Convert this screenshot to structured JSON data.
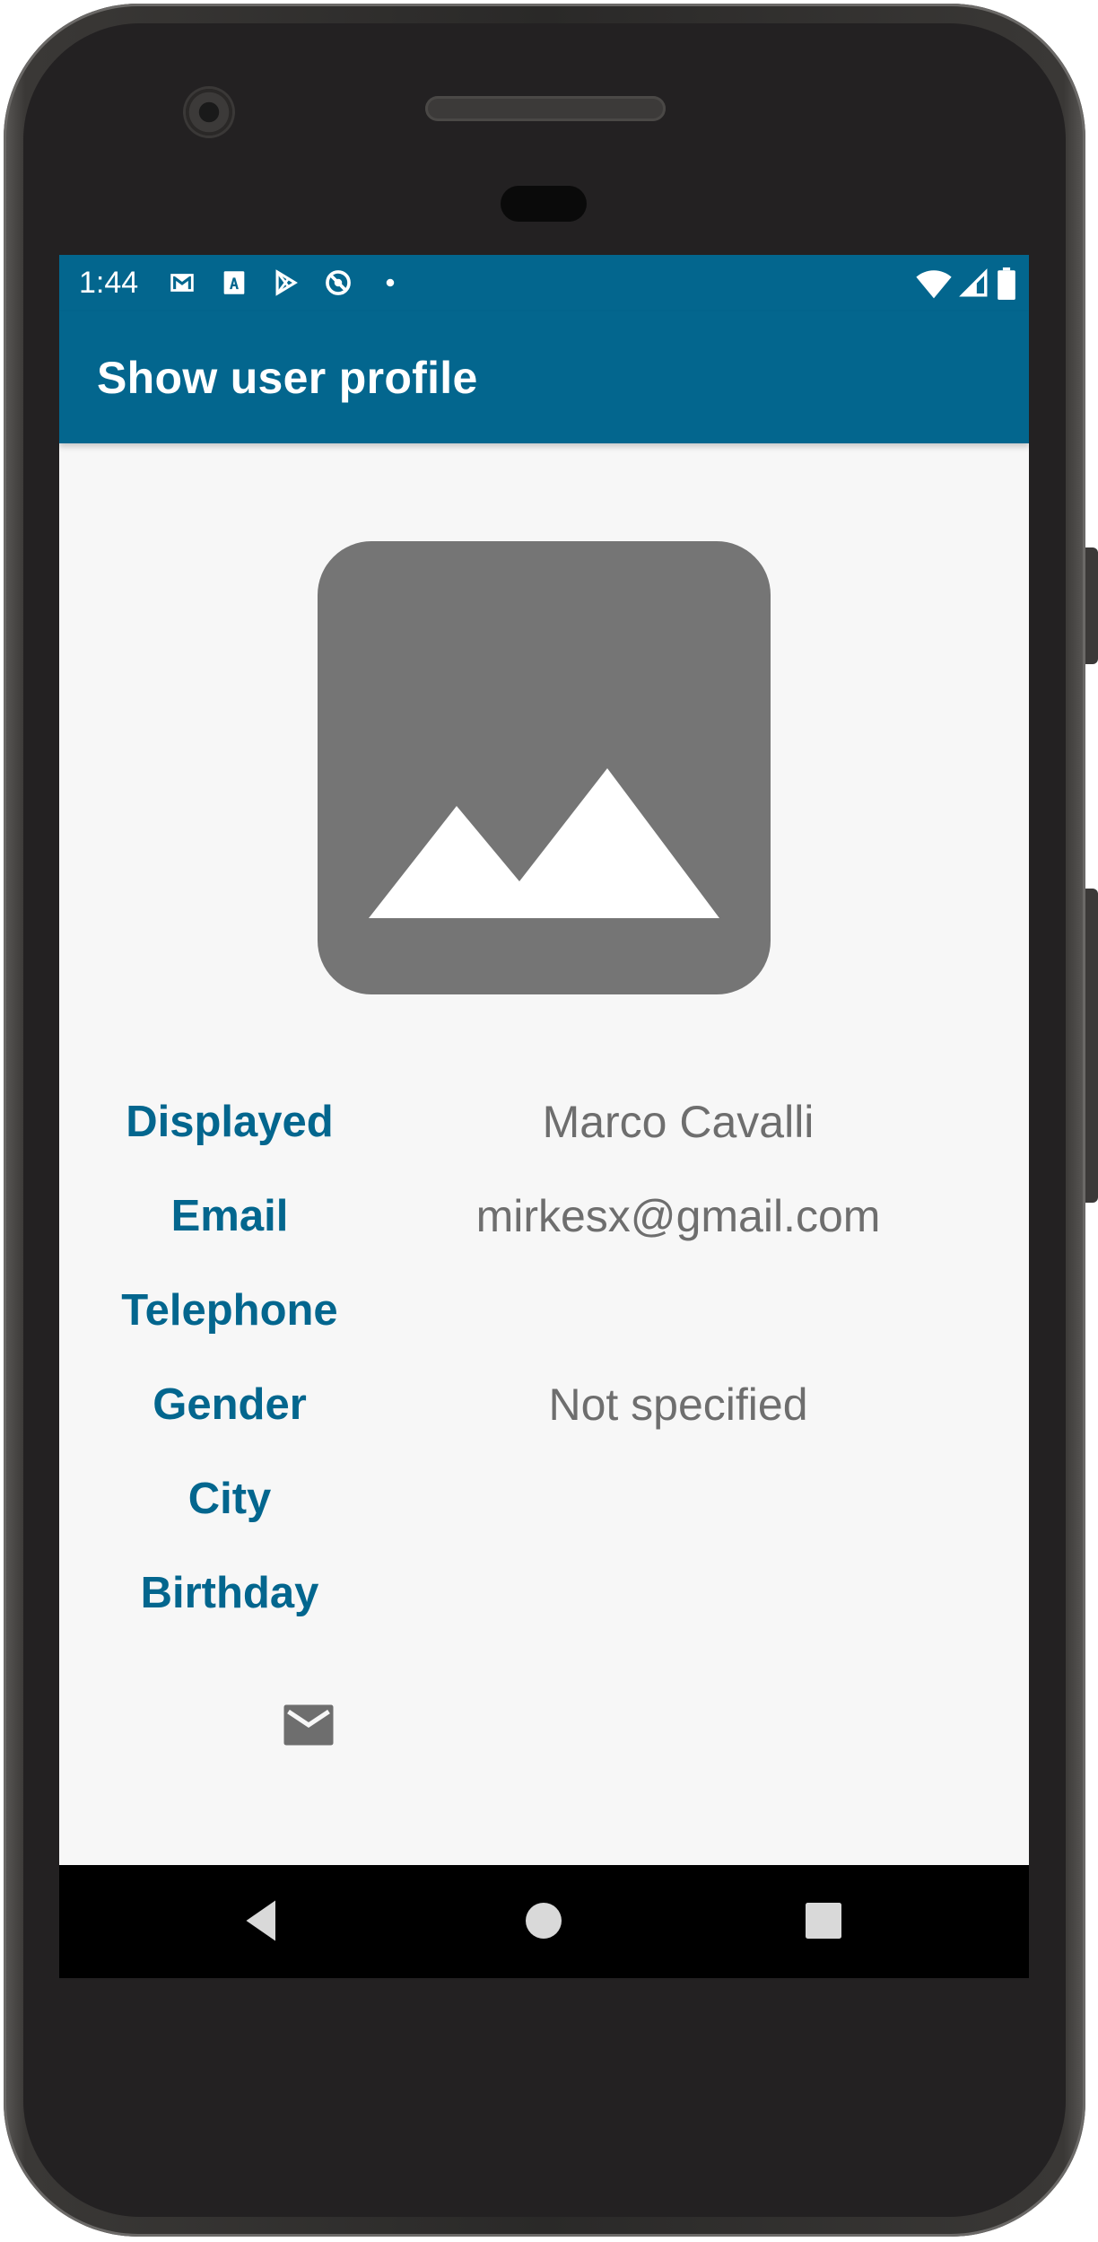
{
  "status_bar": {
    "time": "1:44",
    "icons": [
      "gmail-icon",
      "font-download-icon",
      "play-store-icon",
      "no-sync-icon",
      "dot-icon"
    ],
    "right_icons": [
      "wifi-icon",
      "cellular-signal-icon",
      "battery-icon"
    ],
    "color": "#03668e"
  },
  "app_bar": {
    "title": "Show user profile"
  },
  "profile": {
    "avatar_icon": "image-placeholder-icon",
    "fields": [
      {
        "label": "Displayed",
        "value": "Marco Cavalli"
      },
      {
        "label": "Email",
        "value": "mirkesx@gmail.com"
      },
      {
        "label": "Telephone",
        "value": ""
      },
      {
        "label": "Gender",
        "value": "Not specified"
      },
      {
        "label": "City",
        "value": ""
      },
      {
        "label": "Birthday",
        "value": ""
      }
    ],
    "action_icon": "mail-icon"
  },
  "nav_bar": {
    "buttons": [
      "back-icon",
      "home-icon",
      "recents-icon"
    ]
  },
  "colors": {
    "accent": "#03668e",
    "label": "#03668e",
    "value": "#6e6e6e",
    "background": "#f7f7f7",
    "avatar": "#757575"
  }
}
